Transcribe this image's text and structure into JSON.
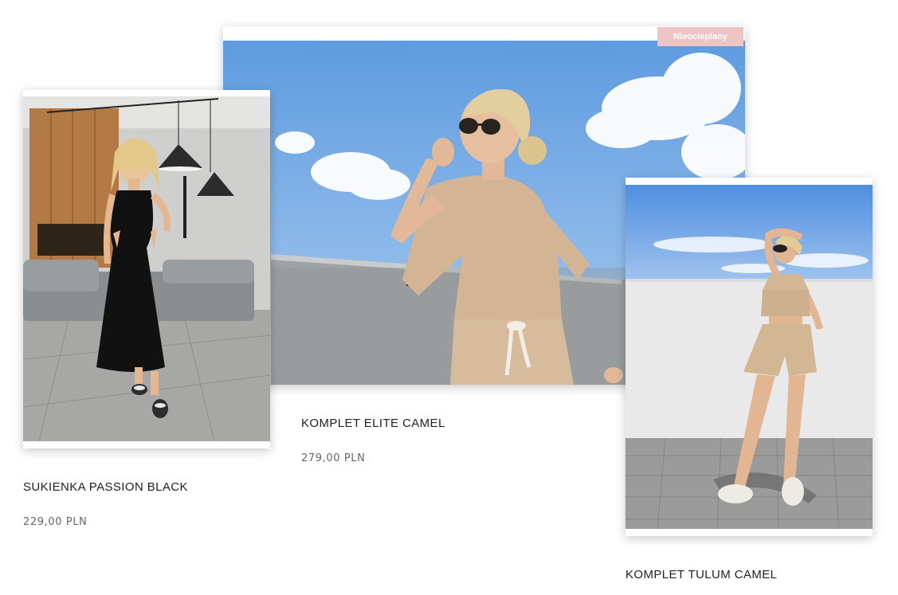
{
  "products": [
    {
      "name": "SUKIENKA PASSION BLACK",
      "price": "229,00 PLN",
      "image_icon": "black-dress-photo"
    },
    {
      "name": "KOMPLET ELITE CAMEL",
      "price": "279,00 PLN",
      "badge": "Nieocieplany",
      "image_icon": "camel-tracksuit-photo"
    },
    {
      "name": "KOMPLET TULUM CAMEL",
      "image_icon": "camel-linen-set-photo"
    }
  ],
  "colors": {
    "badge_bg": "#efc4c4",
    "title": "#222222",
    "price": "#666666"
  }
}
